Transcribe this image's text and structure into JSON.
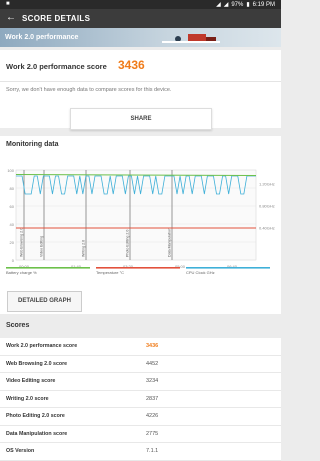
{
  "status": {
    "battery": "97%",
    "time": "6:19 PM"
  },
  "appbar": {
    "title": "SCORE DETAILS"
  },
  "banner": {
    "text": "Work 2.0 performance"
  },
  "summary": {
    "label": "Work 2.0 performance score",
    "score": "3436",
    "note": "Sorry, we don't have enough data to compare scores for this device.",
    "share_label": "SHARE"
  },
  "monitoring": {
    "title": "Monitoring data",
    "y_ticks": [
      "100",
      "80",
      "60",
      "40",
      "20",
      "0"
    ],
    "right_ticks": [
      "1.20GHz",
      "0.80GHz",
      "0.40GHz"
    ],
    "x_ticks": [
      "00:00",
      "01:40",
      "03:20",
      "05:00",
      "06:40"
    ],
    "markers": [
      "Web Browsing 2.0",
      "Video Editing",
      "Writing 2.0",
      "Photo Editing 2.0",
      "Data Manipulation"
    ],
    "legend": [
      "Battery charge %",
      "Temperature °C",
      "CPU Clock GHz"
    ],
    "colors": {
      "battery": "#6cc04a",
      "temperature": "#e2513c",
      "cpu": "#3fb0d8"
    },
    "detail_label": "DETAILED GRAPH"
  },
  "scores": {
    "title": "Scores",
    "rows": [
      {
        "label": "Work 2.0 performance score",
        "value": "3436"
      },
      {
        "label": "Web Browsing 2.0 score",
        "value": "4452"
      },
      {
        "label": "Video Editing score",
        "value": "3234"
      },
      {
        "label": "Writing 2.0 score",
        "value": "2837"
      },
      {
        "label": "Photo Editing 2.0 score",
        "value": "4226"
      },
      {
        "label": "Data Manipulation score",
        "value": "2775"
      },
      {
        "label": "OS Version",
        "value": "7.1.1"
      }
    ]
  }
}
